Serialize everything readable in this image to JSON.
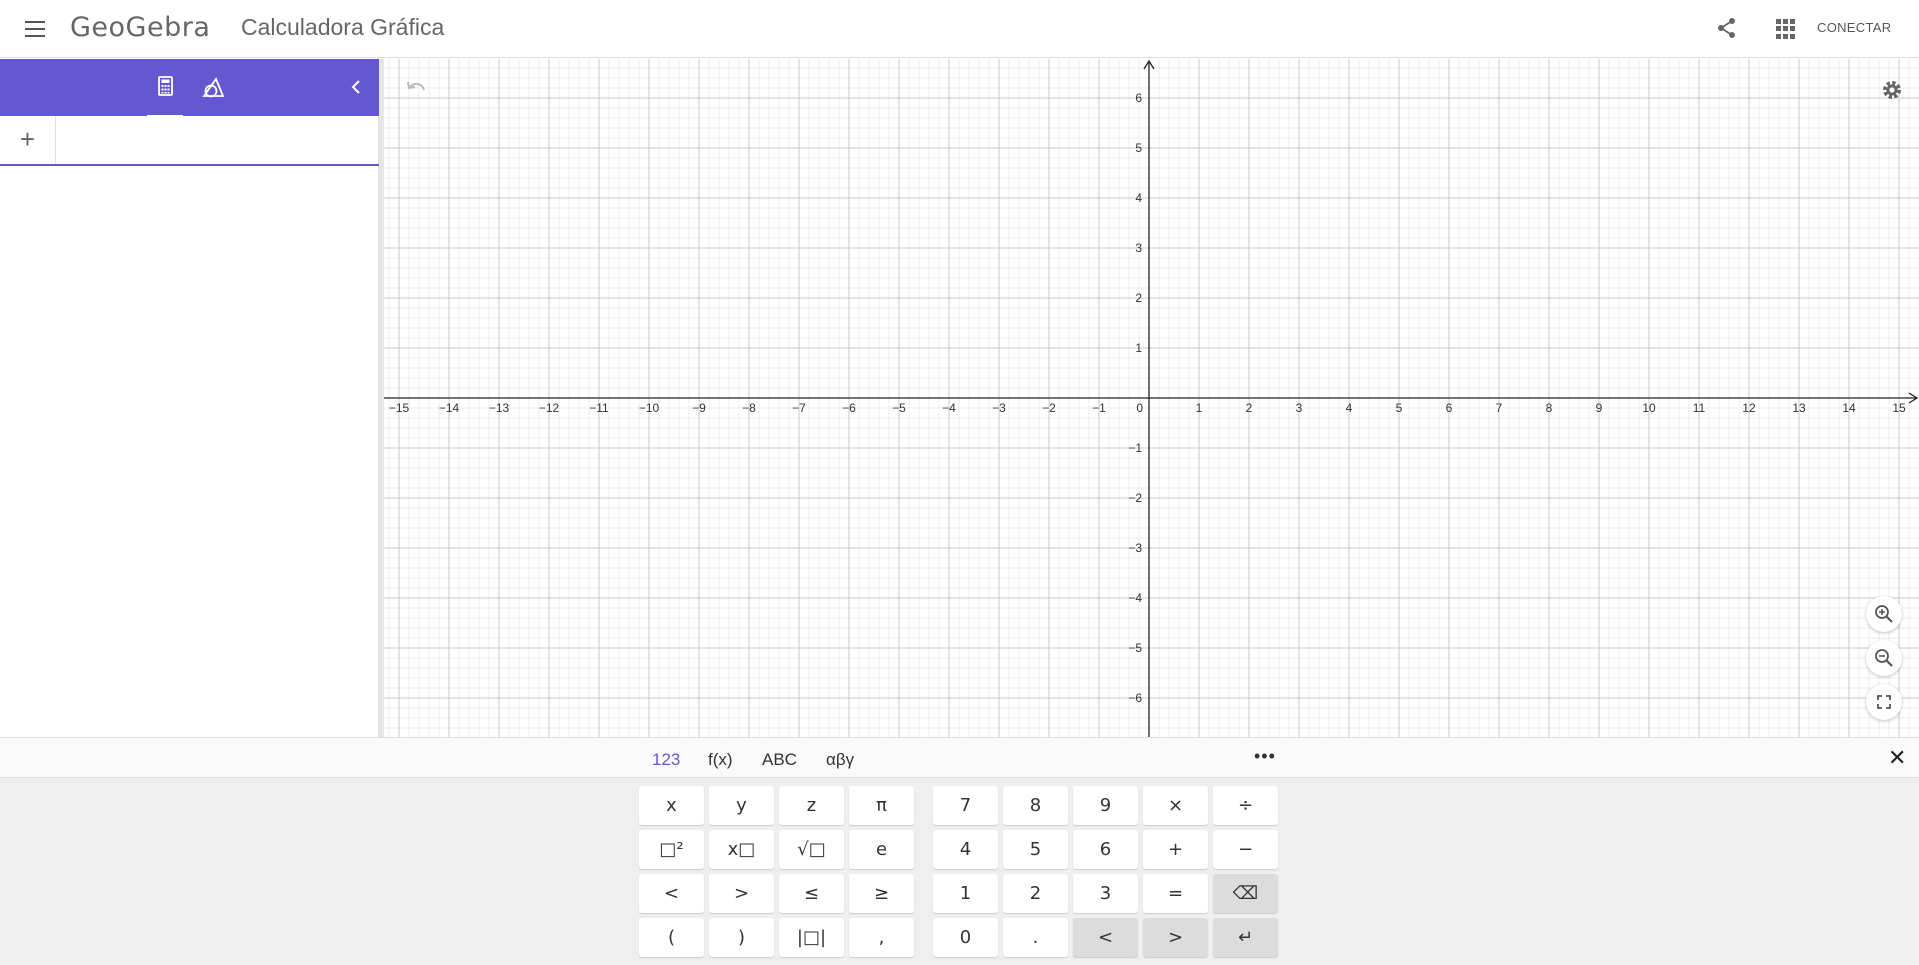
{
  "header": {
    "logo": "GeoGebra",
    "title": "Calculadora Gráfica",
    "login_label": "CONECTAR",
    "menu_icon": "hamburger-menu-icon",
    "share_icon": "share-icon",
    "apps_icon": "apps-grid-icon"
  },
  "algebra": {
    "tabs": [
      {
        "name": "algebra",
        "icon": "calculator-icon",
        "active": true
      },
      {
        "name": "tools",
        "icon": "geometry-tools-icon",
        "active": false
      }
    ],
    "collapse_label": "‹",
    "add_label": "+",
    "input_value": ""
  },
  "graph": {
    "x_ticks": [
      "−15",
      "−14",
      "−13",
      "−12",
      "−11",
      "−10",
      "−9",
      "−8",
      "−7",
      "−6",
      "−5",
      "−4",
      "−3",
      "−2",
      "−1",
      "0",
      "1",
      "2",
      "3",
      "4",
      "5",
      "6",
      "7",
      "8",
      "9",
      "10",
      "11",
      "12",
      "13",
      "14",
      "15"
    ],
    "y_ticks": [
      "6",
      "5",
      "4",
      "3",
      "2",
      "1",
      "−1",
      "−2",
      "−3",
      "−4",
      "−5",
      "−6"
    ],
    "xlim": [
      -15,
      15
    ],
    "ylim": [
      -6,
      6
    ],
    "grid": true
  },
  "keyboard": {
    "tabs": [
      {
        "label": "123",
        "active": true
      },
      {
        "label": "f(x)",
        "active": false
      },
      {
        "label": "ABC",
        "active": false
      },
      {
        "label": "αβγ",
        "active": false
      }
    ],
    "more_label": "•••",
    "close_label": "✕",
    "left_keys": [
      [
        "x",
        "y",
        "z",
        "π"
      ],
      [
        "□²",
        "x□",
        "√□",
        "e"
      ],
      [
        "<",
        ">",
        "≤",
        "≥"
      ],
      [
        "(",
        ")",
        "|□|",
        ","
      ]
    ],
    "right_keys": [
      [
        "7",
        "8",
        "9",
        "×",
        "÷"
      ],
      [
        "4",
        "5",
        "6",
        "+",
        "−"
      ],
      [
        "1",
        "2",
        "3",
        "=",
        "⌫"
      ],
      [
        "0",
        ".",
        "<",
        ">",
        "↵"
      ]
    ]
  },
  "colors": {
    "accent": "#6557d2",
    "grid_minor": "#ececec",
    "grid_major": "#c8c8c8",
    "axis": "#222222"
  }
}
